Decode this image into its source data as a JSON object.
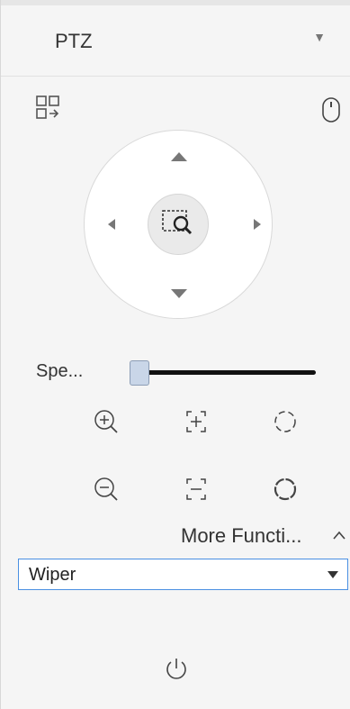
{
  "panel": {
    "title": "PTZ",
    "speed_label": "Spe...",
    "speed_value": 0,
    "more_functions_label": "More Functi...",
    "function_select": {
      "selected": "Wiper"
    }
  },
  "icons": {
    "collapse": "chevron-down-icon",
    "layout_switch": "window-switch-icon",
    "mouse": "mouse-icon",
    "center_zoom": "area-zoom-icon",
    "zoom_in": "zoom-in-icon",
    "zoom_out": "zoom-out-icon",
    "focus_near": "focus-plus-icon",
    "focus_far": "focus-minus-icon",
    "iris_open": "iris-open-icon",
    "iris_close": "iris-close-icon",
    "more_toggle": "chevron-up-icon",
    "power": "power-icon"
  },
  "colors": {
    "panel_bg": "#f5f5f5",
    "select_border": "#4a90e2",
    "slider_thumb": "#c9d6e8"
  }
}
